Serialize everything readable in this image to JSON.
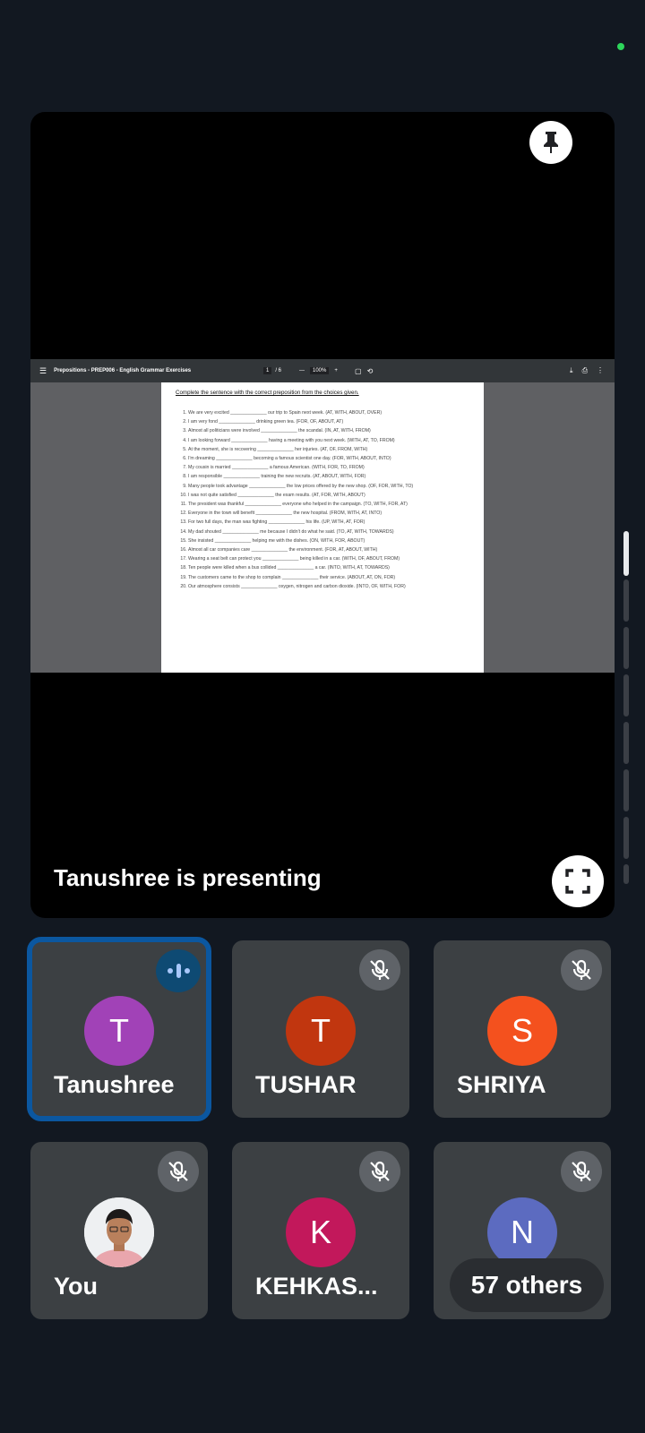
{
  "status": {
    "indicator_color": "#2dd55b"
  },
  "presentation": {
    "presenter_text": "Tanushree is presenting",
    "viewer": {
      "title": "Prepositions - PREP006 - English Grammar Exercises",
      "page_current": "1",
      "page_total": "/ 6",
      "zoom": "100%",
      "zoom_minus": "—",
      "zoom_plus": "+"
    },
    "document": {
      "heading": "Complete the sentence with the correct preposition from the choices given.",
      "items": [
        "We are very excited ______________ our trip to Spain next week. (AT, WITH, ABOUT, OVER)",
        "I am very fond ______________ drinking green tea. (FOR, OF, ABOUT, AT)",
        "Almost all politicians were involved ______________ the scandal. (IN, AT, WITH, FROM)",
        "I am looking forward ______________ having a meeting with you next week. (WITH, AT, TO, FROM)",
        "At the moment, she is recovering ______________ her injuries. (AT, OF, FROM, WITH)",
        "I'm dreaming ______________ becoming a famous scientist one day. (FOR, WITH, ABOUT, INTO)",
        "My cousin is married ______________ a famous American. (WITH, FOR, TO, FROM)",
        "I am responsible ______________ training the new recruits. (AT, ABOUT, WITH, FOR)",
        "Many people took advantage ______________ the low prices offered by the new shop. (OF, FOR, WITH, TO)",
        "I was not quite satisfied ______________ the exam results. (AT, FOR, WITH, ABOUT)",
        "The president was thankful ______________ everyone who helped in the campaign. (TO, WITH, FOR, AT)",
        "Everyone in the town will benefit ______________ the new hospital. (FROM, WITH, AT, INTO)",
        "For two full days, the man was fighting ______________ his life. (UP, WITH, AT, FOR)",
        "My dad shouted ______________ me because I didn't do what he said. (TO, AT, WITH, TOWARDS)",
        "She insisted ______________ helping me with the dishes. (ON, WITH, FOR, ABOUT)",
        "Almost all car companies care ______________ the environment. (FOR, AT, ABOUT, WITH)",
        "Wearing a seat belt can protect you ______________ being killed in a car. (WITH, OF, ABOUT, FROM)",
        "Ten people were killed when a bus collided ______________ a car. (INTO, WITH, AT, TOWARDS)",
        "The customers came to the shop to complain ______________ their service. (ABOUT, AT, ON, FOR)",
        "Our atmosphere consists ______________ oxygen, nitrogen and carbon dioxide. (INTO, OF, WITH, FOR)"
      ]
    }
  },
  "participants": [
    {
      "name": "Tanushree",
      "initial": "T",
      "color": "#a142b7",
      "active": true
    },
    {
      "name": "TUSHAR",
      "initial": "T",
      "color": "#c1360f",
      "muted": true
    },
    {
      "name": "SHRIYA",
      "initial": "S",
      "color": "#f4511e",
      "muted": true
    },
    {
      "name": "You",
      "muted": true
    },
    {
      "name": "KEHKAS...",
      "initial": "K",
      "color": "#c2185b",
      "muted": true
    },
    {
      "name": "N",
      "initial": "N",
      "color": "#5c6bc0",
      "muted": true,
      "others_label": "57 others"
    }
  ]
}
